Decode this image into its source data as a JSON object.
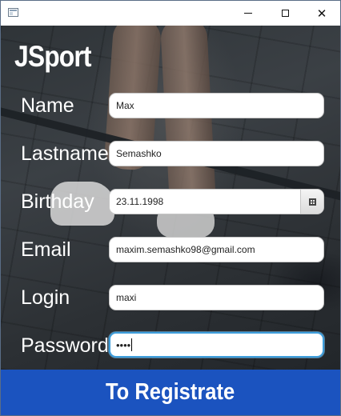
{
  "window": {
    "icon": "app-window-icon",
    "controls": [
      "minimize-icon",
      "maximize-icon",
      "close-icon"
    ],
    "close_glyph": "✕"
  },
  "app": {
    "logo": "JSport"
  },
  "form": {
    "name": {
      "label": "Name",
      "value": "Max"
    },
    "lastname": {
      "label": "Lastname",
      "value": "Semashko"
    },
    "birthday": {
      "label": "Birthday",
      "value": "23.11.1998",
      "icon": "calendar-icon"
    },
    "email": {
      "label": "Email",
      "value": "maxim.semashko98@gmail.com"
    },
    "login": {
      "label": "Login",
      "value": "maxi"
    },
    "password": {
      "label": "Password",
      "value": "••••"
    }
  },
  "actions": {
    "register_label": "To Registrate"
  },
  "colors": {
    "accent": "#1b53bf",
    "focus": "#3d9ddb",
    "text": "#ffffff"
  }
}
